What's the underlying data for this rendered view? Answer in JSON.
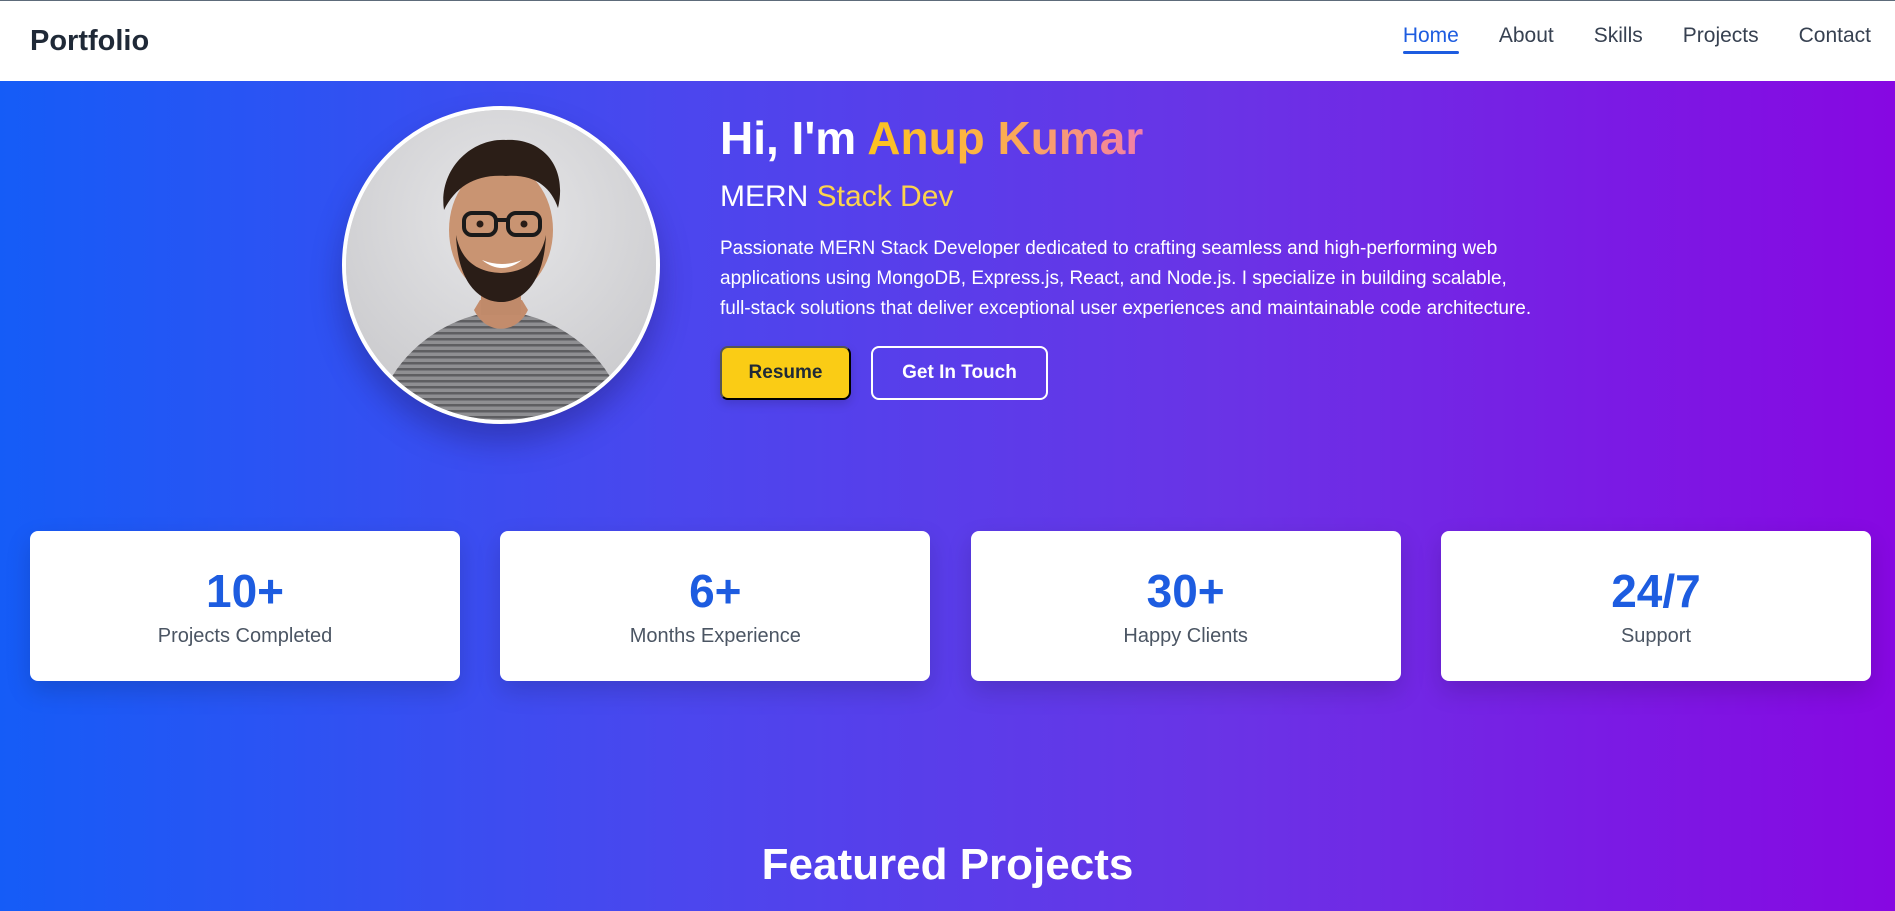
{
  "nav": {
    "brand": "Portfolio",
    "links": [
      {
        "label": "Home",
        "active": true
      },
      {
        "label": "About",
        "active": false
      },
      {
        "label": "Skills",
        "active": false
      },
      {
        "label": "Projects",
        "active": false
      },
      {
        "label": "Contact",
        "active": false
      }
    ]
  },
  "hero": {
    "greeting": "Hi, I'm ",
    "name": "Anup Kumar",
    "role_prefix": "MERN ",
    "role_accent": "Stack Dev",
    "description": "Passionate MERN Stack Developer dedicated to crafting seamless and high-performing web applications using MongoDB, Express.js, React, and Node.js. I specialize in building scalable, full-stack solutions that deliver exceptional user experiences and maintainable code architecture.",
    "resume_button": "Resume",
    "contact_button": "Get In Touch"
  },
  "stats": [
    {
      "value": "10+",
      "label": "Projects Completed"
    },
    {
      "value": "6+",
      "label": "Months Experience"
    },
    {
      "value": "30+",
      "label": "Happy Clients"
    },
    {
      "value": "24/7",
      "label": "Support"
    }
  ],
  "featured": {
    "title": "Featured Projects"
  },
  "colors": {
    "accent_blue": "#1d5ce0",
    "button_yellow": "#facc15",
    "gradient_start": "#155cf7",
    "gradient_end": "#8708e2"
  }
}
